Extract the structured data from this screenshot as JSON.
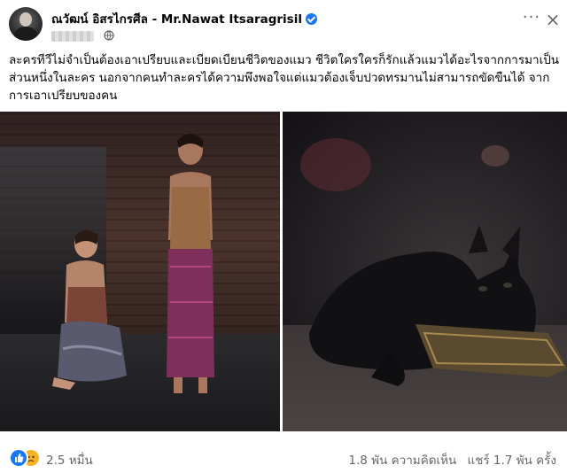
{
  "post": {
    "author": "ณวัฒน์ อิสรไกรศีล - Mr.Nawat Itsaragrisil",
    "verified": true,
    "privacy_icon": "globe-icon",
    "text_lines": [
      "ละครทีวีไม่จำเป็นต้องเอาเปรียบและเบียดเบียนชีวิตของแมว ชีวิตใครใครก็รักแล้วแมวได้อะไรจากการมาเป็น",
      "ส่วนหนึ่งในละคร นอกจากคนทำละครได้ความพึงพอใจแต่แมวต้องเจ็บปวดทรมานไม่สามารถขัดขืนได้ จาก",
      "การเอาเปรียบของคน"
    ]
  },
  "actions": {
    "more_icon": "more-horizontal-icon",
    "more_glyph": "···",
    "close_icon": "close-icon",
    "close_glyph": "×"
  },
  "footer": {
    "reaction_icons": [
      "like-icon",
      "sad-icon"
    ],
    "reaction_count": "2.5 หมื่น",
    "comments": "1.8 พัน ความคิดเห็น",
    "shares": "แชร์ 1.7 พัน ครั้ง"
  },
  "colors": {
    "verified_badge": "#1877f2",
    "like": "#1877f2",
    "sad": "#f7b125",
    "secondary_text": "#65676b"
  }
}
